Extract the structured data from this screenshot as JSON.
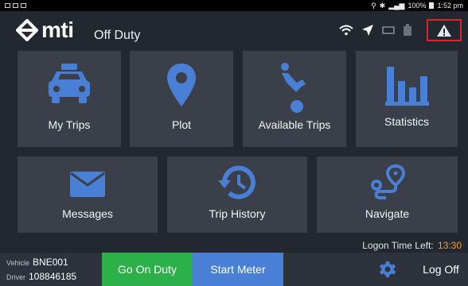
{
  "status_bar": {
    "right_text": "100%",
    "time": "1:52 pm"
  },
  "header": {
    "logo_text": "mti",
    "status": "Off Duty"
  },
  "tiles": [
    {
      "label": "My Trips",
      "icon": "taxi-icon"
    },
    {
      "label": "Plot",
      "icon": "map-pin-icon"
    },
    {
      "label": "Available Trips",
      "icon": "waving-person-icon"
    },
    {
      "label": "Statistics",
      "icon": "bar-chart-icon"
    },
    {
      "label": "Messages",
      "icon": "envelope-icon"
    },
    {
      "label": "Trip History",
      "icon": "history-clock-icon"
    },
    {
      "label": "Navigate",
      "icon": "route-icon"
    }
  ],
  "logon": {
    "label": "Logon Time Left:",
    "time": "13:30"
  },
  "bottom_bar": {
    "vehicle_key": "Vehicle",
    "vehicle_value": "BNE001",
    "driver_key": "Driver",
    "driver_value": "108846185",
    "go_on_duty": "Go On Duty",
    "start_meter": "Start Meter",
    "log_off": "Log Off"
  },
  "colors": {
    "background": "#232730",
    "tile": "#3b3f4a",
    "icon_blue": "#4a7fd6",
    "duty_green": "#2bb04a",
    "meter_blue": "#4a7fd6",
    "alert_red": "#e0232b",
    "logon_time_orange": "#f39b2a"
  }
}
